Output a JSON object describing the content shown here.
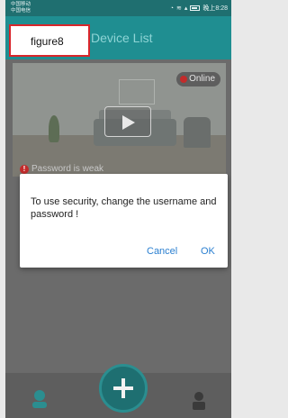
{
  "status_bar": {
    "carrier_line1": "中国移动",
    "carrier_line2": "中国电信",
    "time": "晚上8:28"
  },
  "app_bar": {
    "title": "Device List"
  },
  "annotation": {
    "label": "figure8"
  },
  "camera_card": {
    "status": "Online",
    "warning": "Password is weak"
  },
  "dialog": {
    "message": "To use security, change the username and password !",
    "cancel_label": "Cancel",
    "ok_label": "OK"
  },
  "colors": {
    "accent": "#1f8e91",
    "dialog_button": "#2a7fd0",
    "annotation_border": "#d9262b"
  }
}
